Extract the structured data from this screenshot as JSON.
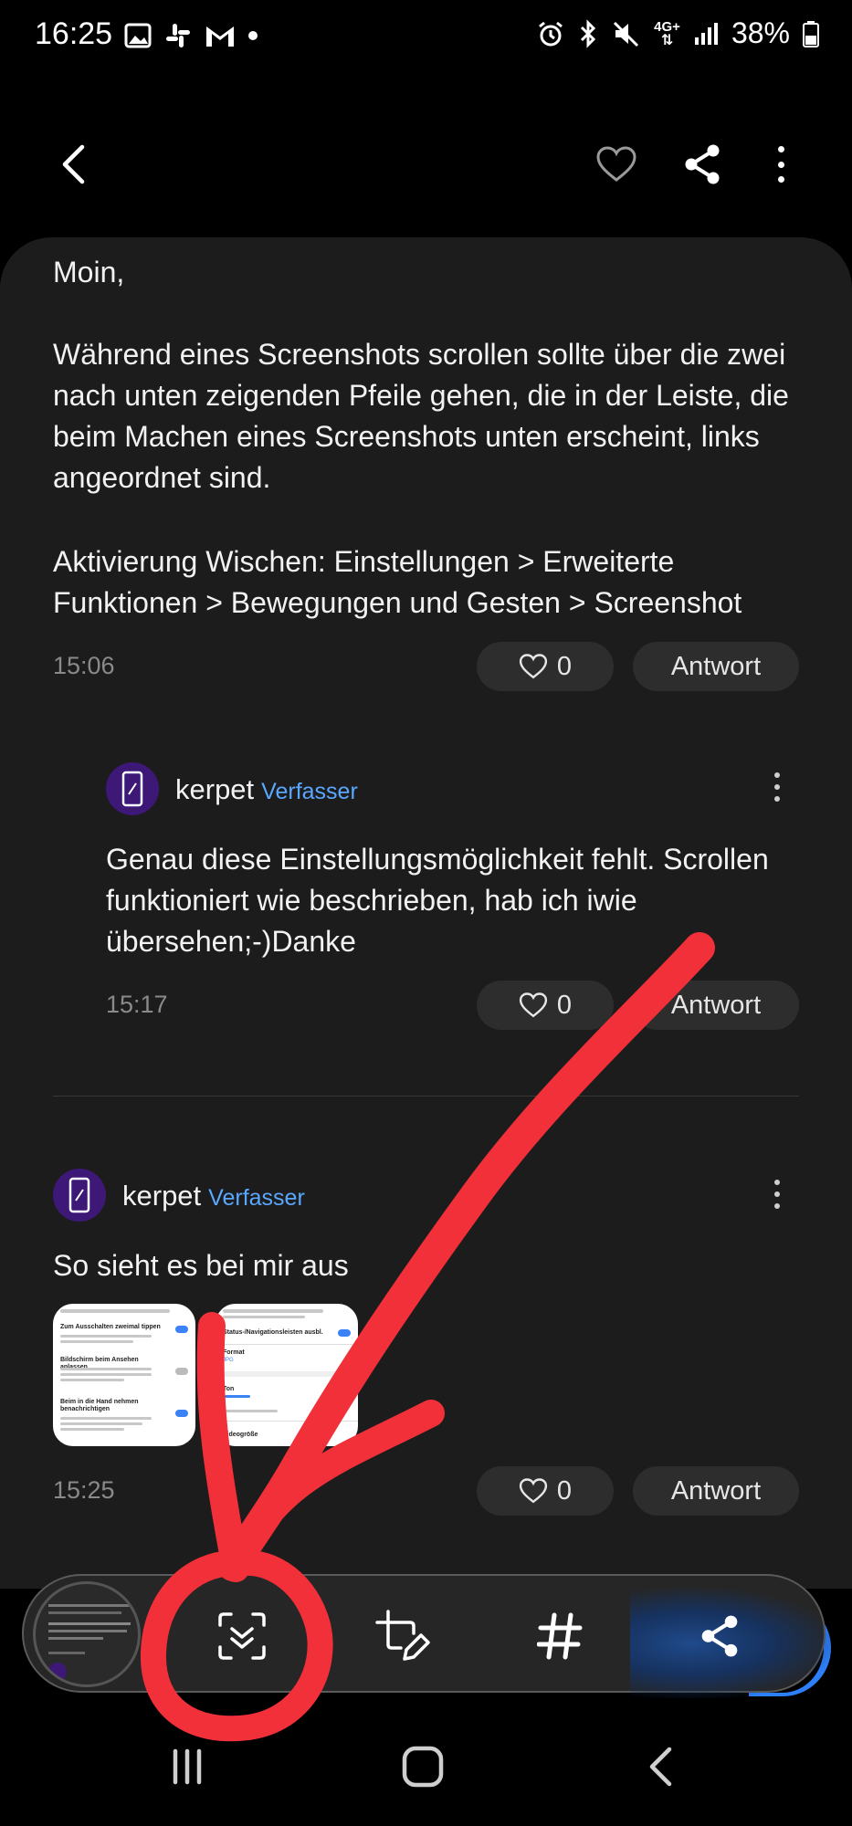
{
  "status_bar": {
    "time": "16:25",
    "network": "4G+",
    "battery": "38%"
  },
  "post": {
    "greeting": "Moin,",
    "paragraph1": "Während eines Screenshots scrollen sollte über die zwei nach unten zeigenden Pfeile gehen, die in der Leiste, die beim Machen eines Screenshots unten erscheint, links angeordnet sind.",
    "paragraph2": "Aktivierung Wischen: Einstellungen > Erweiterte Funktionen > Bewegungen und Gesten > Screenshot",
    "time": "15:06",
    "like_count": "0",
    "reply_label": "Antwort"
  },
  "reply1": {
    "username": "kerpet",
    "badge": "Verfasser",
    "text": "Genau diese Einstellungsmöglichkeit fehlt. Scrollen funktioniert wie beschrieben, hab ich iwie übersehen;-)Danke",
    "time": "15:17",
    "like_count": "0",
    "reply_label": "Antwort"
  },
  "reply2": {
    "username": "kerpet",
    "badge": "Verfasser",
    "text": "So sieht es bei mir aus",
    "time": "15:25",
    "like_count": "0",
    "reply_label": "Antwort",
    "thumb1": {
      "row1": "Zum Ausschalten zweimal tippen",
      "row2": "Bildschirm beim Ansehen anlassen",
      "row3": "Beim in die Hand nehmen benachrichtigen"
    },
    "thumb2": {
      "row1": "Status-/Navigationsleisten ausbl.",
      "row2": "Format",
      "row2_value": "JPG",
      "row3": "Ton",
      "row4": "Videogröße"
    }
  },
  "colors": {
    "background": "#000000",
    "card": "#1c1c1c",
    "pill": "#2d2d2d",
    "badge": "#5aa7ff",
    "annotation": "#f2303a",
    "accent_blue": "#2d7ff9"
  },
  "icons": {
    "back": "chevron-left-icon",
    "favorite": "heart-outline-icon",
    "share": "share-icon",
    "more": "kebab-vertical-icon",
    "scroll_capture": "scroll-capture-icon",
    "crop_edit": "crop-edit-icon",
    "tag": "hashtag-icon",
    "nav_recents": "recents-icon",
    "nav_home": "home-icon",
    "nav_back": "back-icon"
  }
}
